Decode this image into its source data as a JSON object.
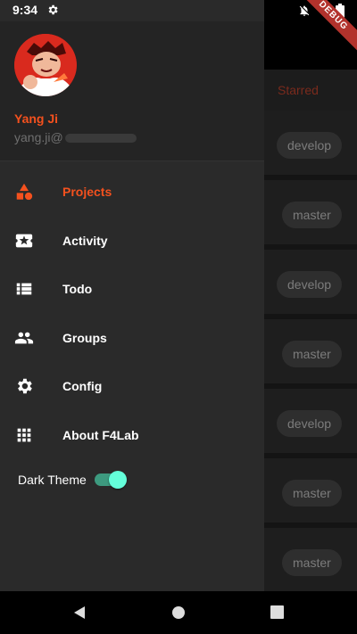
{
  "status_bar": {
    "time": "9:34",
    "debug_banner": "DEBUG"
  },
  "user": {
    "name": "Yang Ji",
    "email_visible": "yang.ji@"
  },
  "menu": [
    {
      "label": "Projects",
      "icon": "projects-icon",
      "active": true
    },
    {
      "label": "Activity",
      "icon": "activity-icon",
      "active": false
    },
    {
      "label": "Todo",
      "icon": "todo-icon",
      "active": false
    },
    {
      "label": "Groups",
      "icon": "groups-icon",
      "active": false
    },
    {
      "label": "Config",
      "icon": "gear-icon",
      "active": false
    },
    {
      "label": "About F4Lab",
      "icon": "apps-grid-icon",
      "active": false
    }
  ],
  "theme_toggle": {
    "label": "Dark Theme",
    "on": true
  },
  "background": {
    "tab_label": "Starred",
    "branches": [
      "develop",
      "master",
      "develop",
      "master",
      "develop",
      "master",
      "master"
    ]
  },
  "colors": {
    "accent": "#f4511e",
    "toggle": "#64ffda",
    "drawer_bg": "#2a2a2a"
  }
}
